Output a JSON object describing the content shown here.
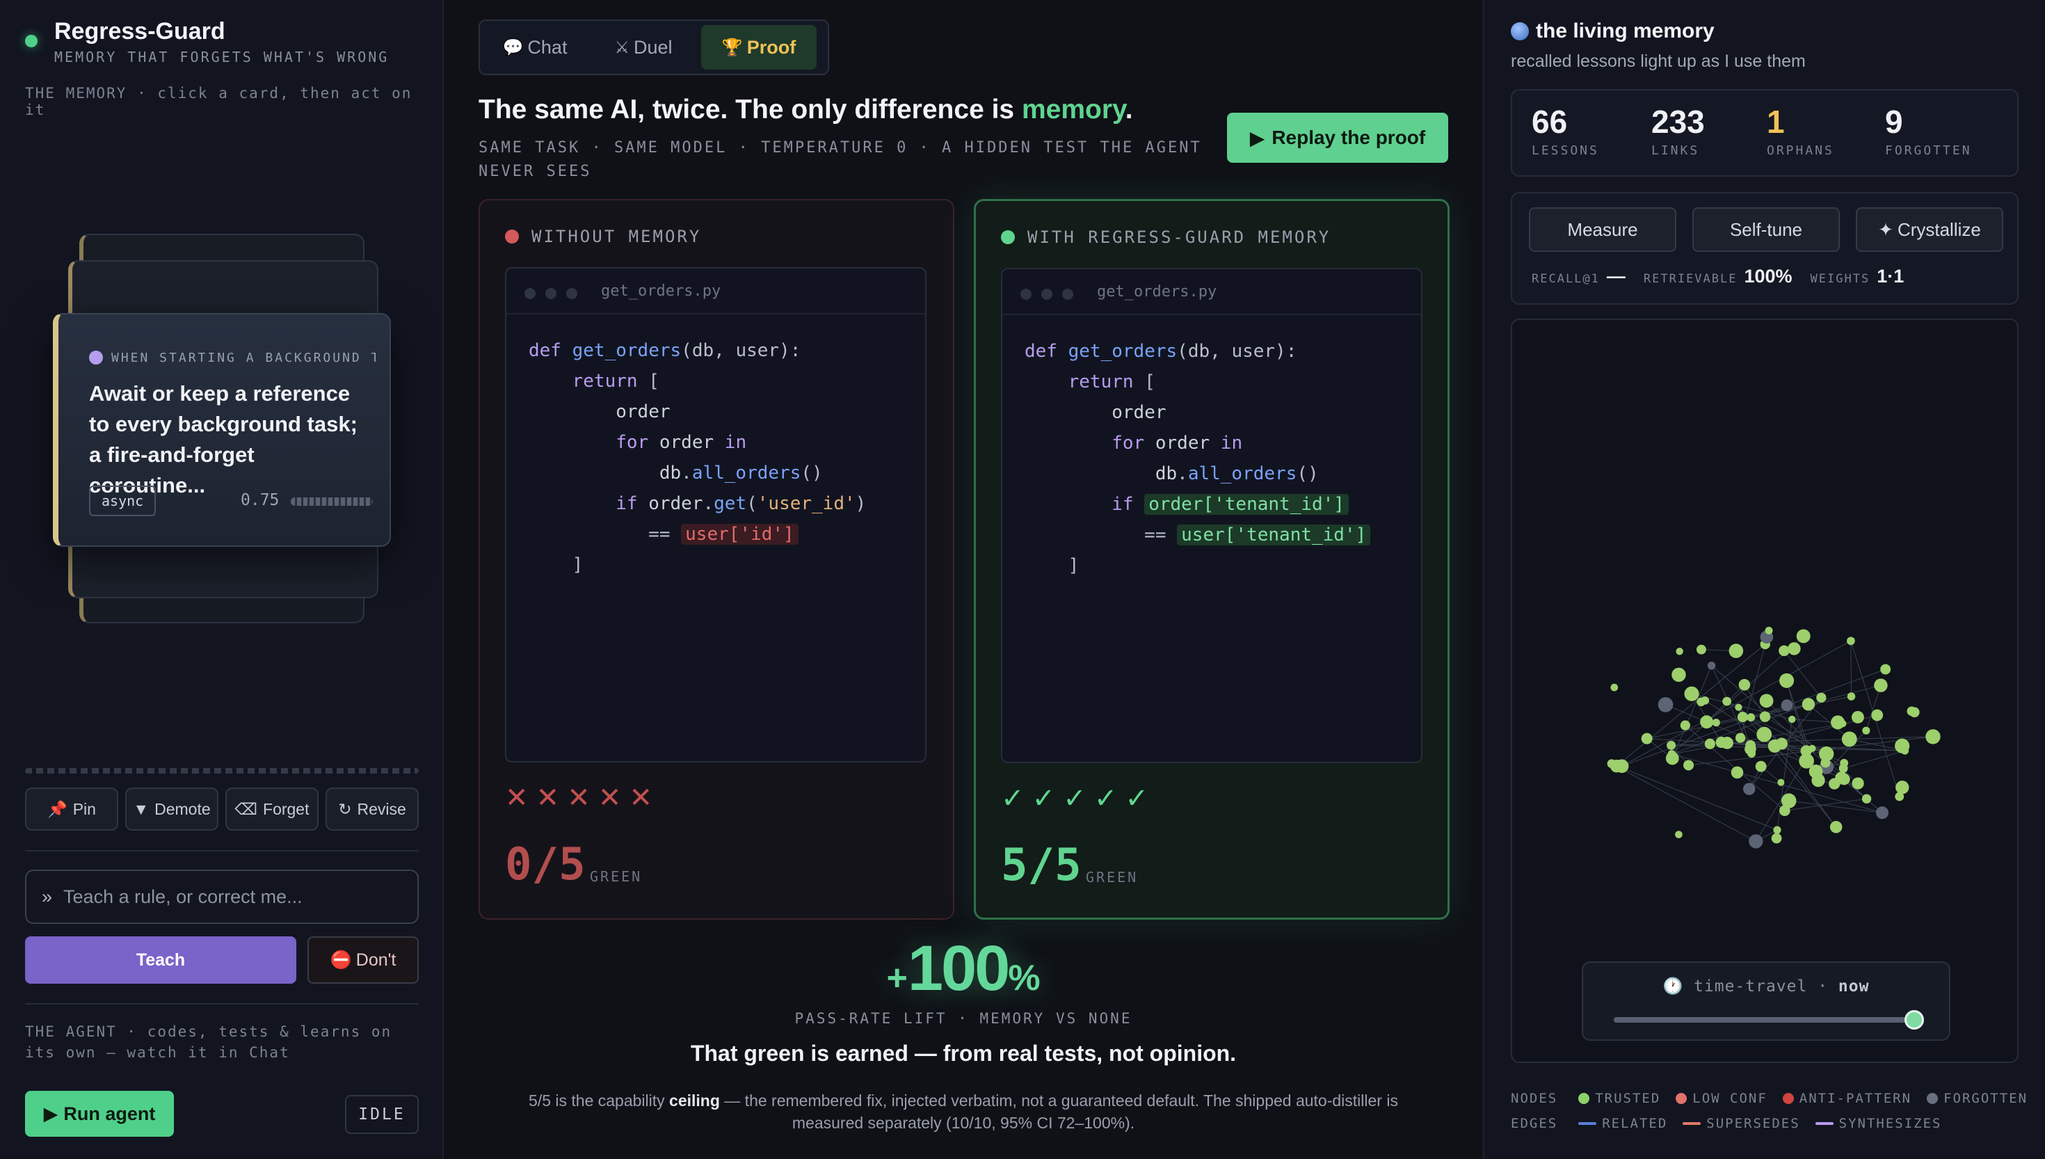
{
  "brand": {
    "title": "Regress-Guard",
    "subtitle": "MEMORY THAT FORGETS WHAT'S WRONG"
  },
  "memory_hint": "THE MEMORY · click a card, then act on it",
  "card": {
    "heading": "WHEN STARTING A BACKGROUND T…",
    "body": "Await or keep a reference to every background task; a fire-and-forget coroutine...",
    "tag": "async",
    "score": "0.75"
  },
  "actions": [
    {
      "icon": "📌",
      "label": "Pin"
    },
    {
      "icon": "▼",
      "label": "Demote"
    },
    {
      "icon": "⌫",
      "label": "Forget"
    },
    {
      "icon": "↻",
      "label": "Revise"
    }
  ],
  "teach": {
    "prompt_icon": "»",
    "placeholder": "Teach a rule, or correct me...",
    "button": "Teach",
    "dont_icon": "⛔",
    "dont_label": "Don't"
  },
  "agent": {
    "hint": "THE AGENT · codes, tests & learns on its own — watch it in Chat",
    "run_label": "Run agent",
    "run_icon": "▶",
    "status": "IDLE"
  },
  "tabs": [
    {
      "icon": "💬",
      "label": "Chat",
      "active": false
    },
    {
      "icon": "⚔",
      "label": "Duel",
      "active": false
    },
    {
      "icon": "🏆",
      "label": "Proof",
      "active": true
    }
  ],
  "proof": {
    "headline_pre": "The same AI, twice. The only difference is ",
    "headline_hl": "memory",
    "headline_post": ".",
    "subline": "SAME TASK · SAME MODEL · TEMPERATURE 0 · A HIDDEN TEST THE AGENT NEVER SEES",
    "replay_icon": "▶",
    "replay_label": "Replay the proof",
    "without": {
      "label": "WITHOUT MEMORY",
      "file": "get_orders.py",
      "marks": "✕ ✕ ✕ ✕ ✕",
      "score": "0/5",
      "score_label": "GREEN"
    },
    "with": {
      "label": "WITH REGRESS-GUARD MEMORY",
      "file": "get_orders.py",
      "marks": "✓ ✓ ✓ ✓ ✓",
      "score": "5/5",
      "score_label": "GREEN"
    },
    "code_bad_hl1": "user['id']",
    "code_good_hl1": "order['tenant_id']",
    "code_good_hl2": "user['tenant_id']",
    "lift_sign": "+",
    "lift_value": "100",
    "lift_unit": "%",
    "lift_label": "PASS-RATE LIFT · MEMORY VS NONE",
    "earned": "That green is earned — from real tests, not opinion.",
    "footnote_pre": "5/5 is the capability ",
    "footnote_bold": "ceiling",
    "footnote_post": " — the remembered fix, injected verbatim, not a guaranteed default. The shipped auto-distiller is measured separately (10/10, 95% CI 72–100%)."
  },
  "living_memory": {
    "title": "the living memory",
    "subtitle": "recalled lessons light up as I use them",
    "stats": [
      {
        "value": "66",
        "label": "LESSONS",
        "color": "#f0f1f5"
      },
      {
        "value": "233",
        "label": "LINKS",
        "color": "#f0f1f5"
      },
      {
        "value": "1",
        "label": "ORPHANS",
        "color": "#f0c257"
      },
      {
        "value": "9",
        "label": "FORGOTTEN",
        "color": "#f0f1f5"
      }
    ],
    "tools": [
      "Measure",
      "Self-tune",
      "Crystallize"
    ],
    "crystallize_icon": "✦",
    "metrics": {
      "recall_label": "RECALL@1",
      "recall_value": "—",
      "retrievable_label": "RETRIEVABLE",
      "retrievable_value": "100%",
      "weights_label": "WEIGHTS",
      "weights_value": "1·1"
    },
    "time_travel": {
      "icon": "🕐",
      "label": "time-travel · ",
      "value": "now",
      "position": 1.0
    },
    "legend_nodes_label": "NODES",
    "legend_nodes": [
      {
        "label": "TRUSTED",
        "color": "#8fd06a"
      },
      {
        "label": "LOW CONF",
        "color": "#e0736a"
      },
      {
        "label": "ANTI-PATTERN",
        "color": "#d0453e"
      },
      {
        "label": "FORGOTTEN",
        "color": "#6a7080"
      }
    ],
    "legend_edges_label": "EDGES",
    "legend_edges": [
      {
        "label": "RELATED",
        "color": "#5b7fd6"
      },
      {
        "label": "SUPERSEDES",
        "color": "#e07a6a"
      },
      {
        "label": "SYNTHESIZES",
        "color": "#b79cf0"
      }
    ]
  }
}
